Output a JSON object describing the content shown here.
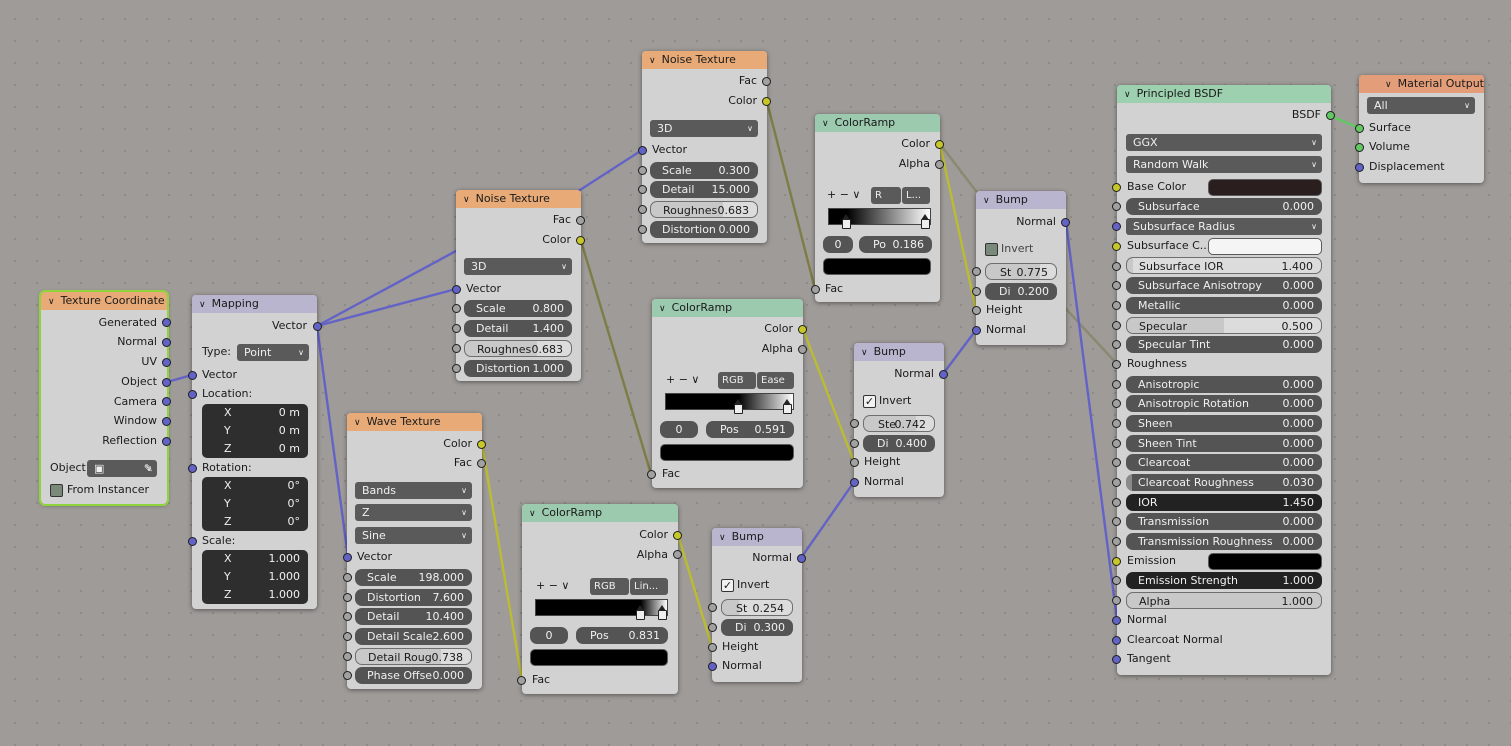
{
  "nodes": {
    "texcoord": {
      "title": "Texture Coordinate",
      "outputs": [
        "Generated",
        "Normal",
        "UV",
        "Object",
        "Camera",
        "Window",
        "Reflection"
      ],
      "object_label": "Object:",
      "from_instancer": "From Instancer"
    },
    "mapping": {
      "title": "Mapping",
      "output": "Vector",
      "type_label": "Type:",
      "type_value": "Point",
      "vector": "Vector",
      "location": "Location:",
      "loc": [
        [
          "X",
          "0 m"
        ],
        [
          "Y",
          "0 m"
        ],
        [
          "Z",
          "0 m"
        ]
      ],
      "rotation": "Rotation:",
      "rot": [
        [
          "X",
          "0°"
        ],
        [
          "Y",
          "0°"
        ],
        [
          "Z",
          "0°"
        ]
      ],
      "scale": "Scale:",
      "scl": [
        [
          "X",
          "1.000"
        ],
        [
          "Y",
          "1.000"
        ],
        [
          "Z",
          "1.000"
        ]
      ]
    },
    "noise1": {
      "title": "Noise Texture",
      "out_fac": "Fac",
      "out_color": "Color",
      "dim": "3D",
      "vector": "Vector",
      "fields": [
        [
          "Scale",
          "0.800"
        ],
        [
          "Detail",
          "1.400"
        ],
        [
          "Roughnes",
          "0.683"
        ],
        [
          "Distortion",
          "1.000"
        ]
      ]
    },
    "noise2": {
      "title": "Noise Texture",
      "out_fac": "Fac",
      "out_color": "Color",
      "dim": "3D",
      "vector": "Vector",
      "fields": [
        [
          "Scale",
          "0.300"
        ],
        [
          "Detail",
          "15.000"
        ],
        [
          "Roughnes",
          "0.683"
        ],
        [
          "Distortion",
          "0.000"
        ]
      ]
    },
    "wave": {
      "title": "Wave Texture",
      "out_color": "Color",
      "out_fac": "Fac",
      "type": "Bands",
      "dir": "Z",
      "profile": "Sine",
      "vector": "Vector",
      "fields": [
        [
          "Scale",
          "198.000"
        ],
        [
          "Distortion",
          "7.600"
        ],
        [
          "Detail",
          "10.400"
        ],
        [
          "Detail Scale",
          "2.600"
        ],
        [
          "Detail Roug",
          "0.738"
        ],
        [
          "Phase Offse",
          "0.000"
        ]
      ]
    },
    "ramp1": {
      "title": "ColorRamp",
      "out_color": "Color",
      "out_alpha": "Alpha",
      "tools": "+ − ∨",
      "mode": "R",
      "interp": "L...",
      "index": "0",
      "pos_label": "Po",
      "pos": "0.186",
      "fac": "Fac"
    },
    "ramp2": {
      "title": "ColorRamp",
      "out_color": "Color",
      "out_alpha": "Alpha",
      "tools": "+ − ∨",
      "mode": "RGB",
      "interp": "Ease",
      "index": "0",
      "pos_label": "Pos",
      "pos": "0.591",
      "fac": "Fac"
    },
    "ramp3": {
      "title": "ColorRamp",
      "out_color": "Color",
      "out_alpha": "Alpha",
      "tools": "+ − ∨",
      "mode": "RGB",
      "interp": "Lin...",
      "index": "0",
      "pos_label": "Pos",
      "pos": "0.831",
      "fac": "Fac"
    },
    "bump1": {
      "title": "Bump",
      "out_normal": "Normal",
      "invert": "Invert",
      "st_label": "St",
      "st": "0.775",
      "di_label": "Di",
      "di": "0.200",
      "height": "Height",
      "normal": "Normal"
    },
    "bump2": {
      "title": "Bump",
      "out_normal": "Normal",
      "invert": "Invert",
      "st_label": "Ste",
      "st": "0.742",
      "di_label": "Di",
      "di": "0.400",
      "height": "Height",
      "normal": "Normal"
    },
    "bump3": {
      "title": "Bump",
      "out_normal": "Normal",
      "invert": "Invert",
      "st_label": "St",
      "st": "0.254",
      "di_label": "Di",
      "di": "0.300",
      "height": "Height",
      "normal": "Normal"
    },
    "bsdf": {
      "title": "Principled BSDF",
      "out": "BSDF",
      "dist": "GGX",
      "sss": "Random Walk",
      "base_color": "Base Color",
      "fields": [
        [
          "Subsurface",
          "0.000"
        ],
        [
          "Subsurface Radius",
          ""
        ],
        [
          "Subsurface C...",
          ""
        ],
        [
          "Subsurface IOR",
          "1.400"
        ],
        [
          "Subsurface Anisotropy",
          "0.000"
        ],
        [
          "Metallic",
          "0.000"
        ],
        [
          "Specular",
          "0.500"
        ],
        [
          "Specular Tint",
          "0.000"
        ],
        [
          "Roughness",
          ""
        ],
        [
          "Anisotropic",
          "0.000"
        ],
        [
          "Anisotropic Rotation",
          "0.000"
        ],
        [
          "Sheen",
          "0.000"
        ],
        [
          "Sheen Tint",
          "0.000"
        ],
        [
          "Clearcoat",
          "0.000"
        ],
        [
          "Clearcoat Roughness",
          "0.030"
        ],
        [
          "IOR",
          "1.450"
        ],
        [
          "Transmission",
          "0.000"
        ],
        [
          "Transmission Roughness",
          "0.000"
        ],
        [
          "Emission",
          ""
        ],
        [
          "Emission Strength",
          "1.000"
        ],
        [
          "Alpha",
          "1.000"
        ]
      ],
      "normal": "Normal",
      "clearcoat_normal": "Clearcoat Normal",
      "tangent": "Tangent"
    },
    "output": {
      "title": "Material Output",
      "target": "All",
      "surface": "Surface",
      "volume": "Volume",
      "displacement": "Displacement"
    }
  },
  "colors": {
    "texture_header": "#e8ab78",
    "converter_header": "#9bcaae",
    "color_socket": "#c7c729",
    "vector_socket": "#6363c7",
    "float_socket": "#a1a1a1",
    "shader_socket": "#63c763",
    "selected_outline": "#8fd43a",
    "base_color": "#2a1e1e"
  }
}
